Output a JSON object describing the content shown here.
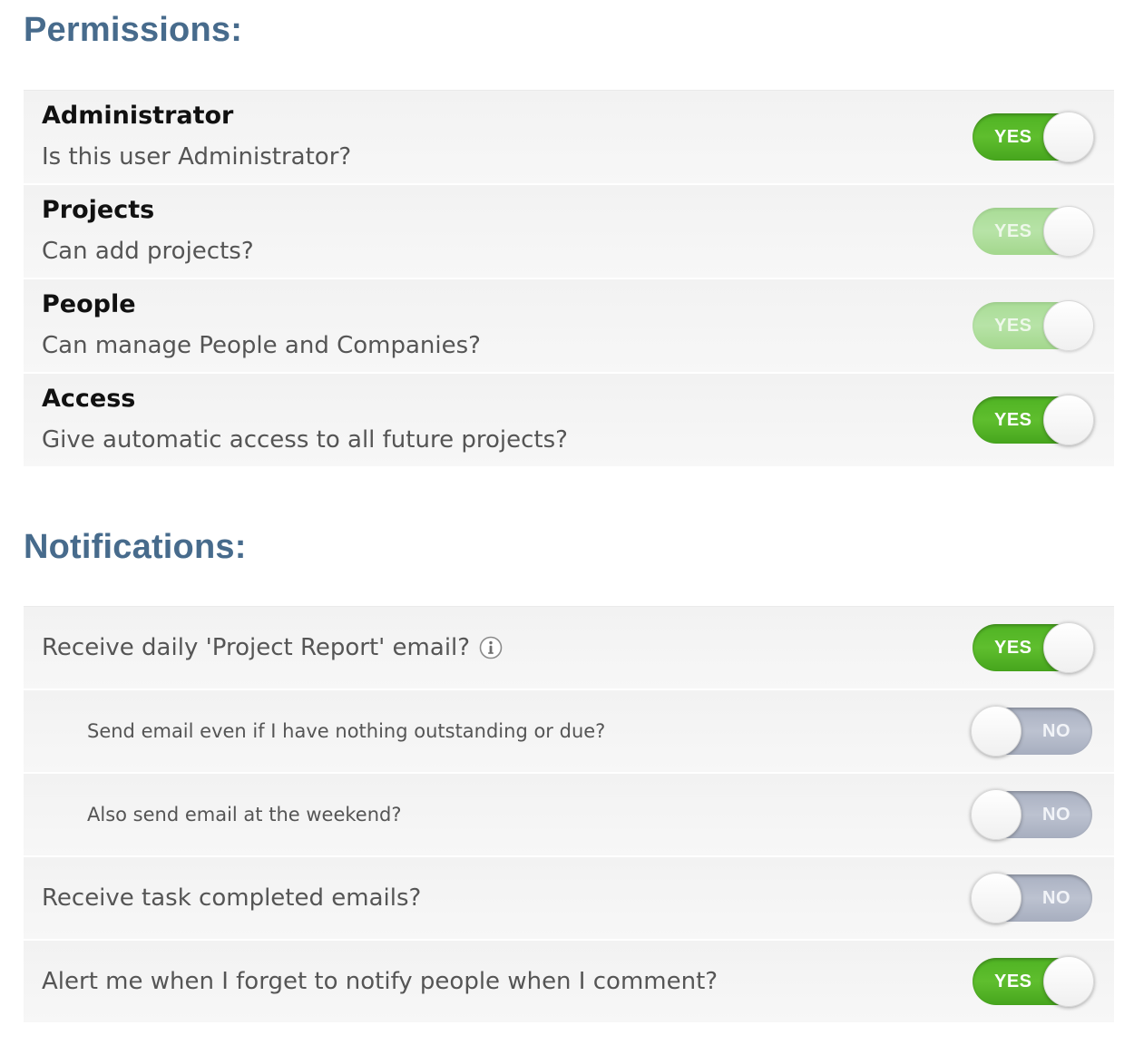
{
  "permissions": {
    "title": "Permissions:",
    "rows": [
      {
        "title": "Administrator",
        "description": "Is this user Administrator?",
        "toggle": "YES",
        "enabled": true
      },
      {
        "title": "Projects",
        "description": "Can add projects?",
        "toggle": "YES",
        "enabled": false
      },
      {
        "title": "People",
        "description": "Can manage People and Companies?",
        "toggle": "YES",
        "enabled": false
      },
      {
        "title": "Access",
        "description": "Give automatic access to all future projects?",
        "toggle": "YES",
        "enabled": true
      }
    ]
  },
  "notifications": {
    "title": "Notifications:",
    "rows": [
      {
        "label": "Receive daily 'Project Report' email?",
        "toggle": "YES",
        "info_icon": "info-icon"
      },
      {
        "label": "Send email even if I have nothing outstanding or due?",
        "toggle": "NO",
        "indented": true
      },
      {
        "label": "Also send email at the weekend?",
        "toggle": "NO",
        "indented": true
      },
      {
        "label": "Receive task completed emails?",
        "toggle": "NO"
      },
      {
        "label": "Alert me when I forget to notify people when I comment?",
        "toggle": "YES"
      }
    ]
  },
  "colors": {
    "heading": "#476b8c",
    "toggle_on": "#52b526",
    "toggle_on_disabled": "#b0df9e",
    "toggle_off": "#b3b9c8",
    "row_background": "#f4f4f4"
  }
}
